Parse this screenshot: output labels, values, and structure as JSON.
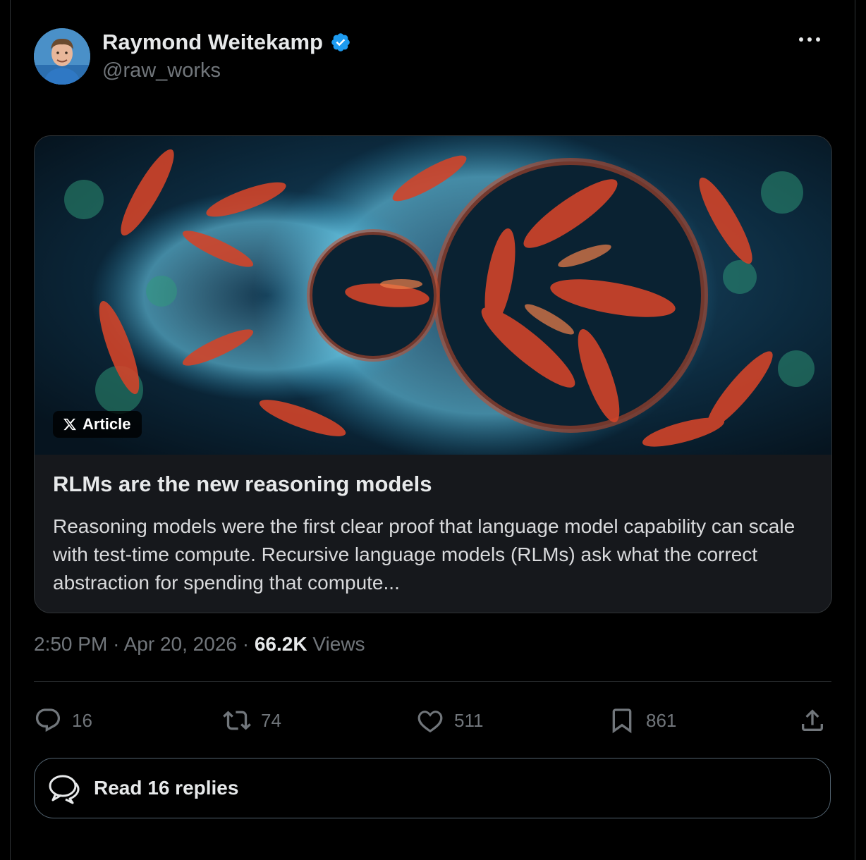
{
  "author": {
    "name": "Raymond Weitekamp",
    "handle": "@raw_works",
    "verified": true,
    "verified_color": "#1d9bf0"
  },
  "more_icon": "more-horizontal-icon",
  "article_card": {
    "badge_label": "Article",
    "title": "RLMs are the new reasoning models",
    "description": "Reasoning models were the first clear proof that language model capability can scale with test-time compute. Recursive language models (RLMs) ask what the correct abstraction for spending that compute..."
  },
  "meta": {
    "time": "2:50 PM",
    "date": "Apr 20, 2026",
    "views_count": "66.2K",
    "views_label": "Views"
  },
  "actions": {
    "replies": "16",
    "reposts": "74",
    "likes": "511",
    "bookmarks": "861"
  },
  "read_replies_label": "Read 16 replies",
  "colors": {
    "background": "#000000",
    "card_background": "#16181c",
    "border": "#2f3336",
    "secondary_text": "#71767b"
  }
}
